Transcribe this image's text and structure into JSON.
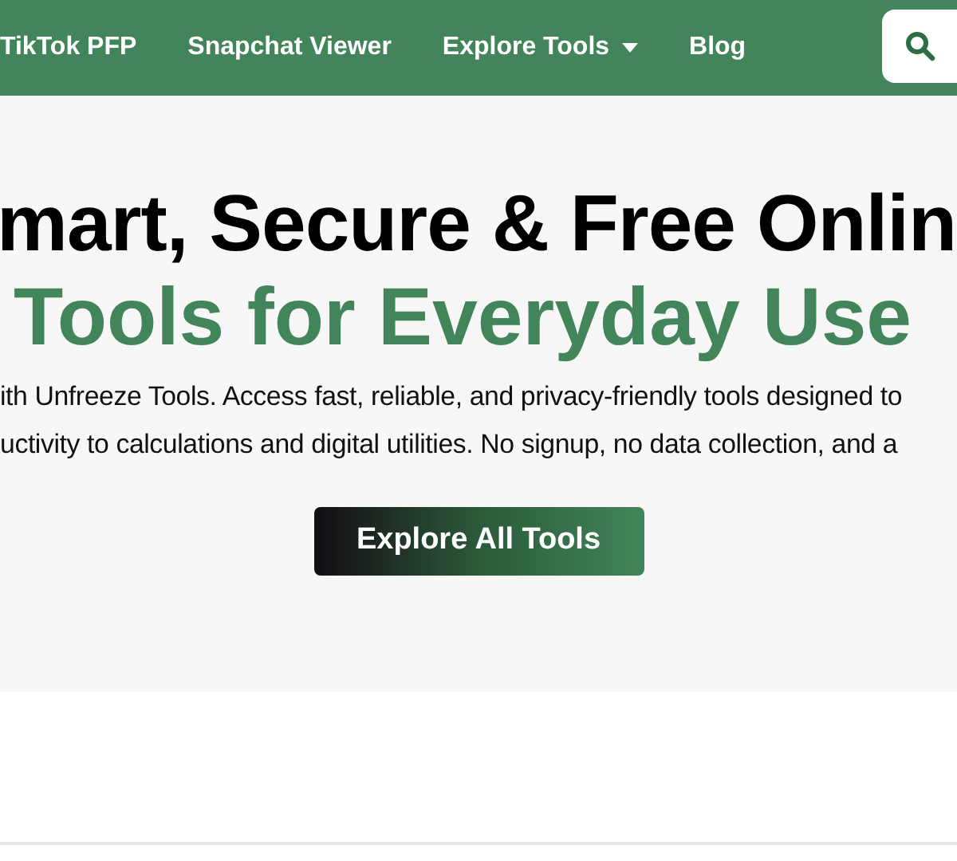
{
  "nav": {
    "links": [
      {
        "label": "TikTok PFP",
        "has_dropdown": false
      },
      {
        "label": "Snapchat Viewer",
        "has_dropdown": false
      },
      {
        "label": "Explore Tools",
        "has_dropdown": true
      },
      {
        "label": "Blog",
        "has_dropdown": false
      }
    ],
    "search": {
      "kind": "search"
    }
  },
  "hero": {
    "title_lines": [
      "mart, Secure & Free Onlin",
      "Tools for Everyday Use"
    ],
    "description_lines": [
      "ith Unfreeze Tools. Access fast, reliable, and privacy-friendly tools designed to",
      "uctivity to calculations and digital utilities. No signup, no data collection, and a"
    ],
    "button": "Explore All Tools"
  }
}
